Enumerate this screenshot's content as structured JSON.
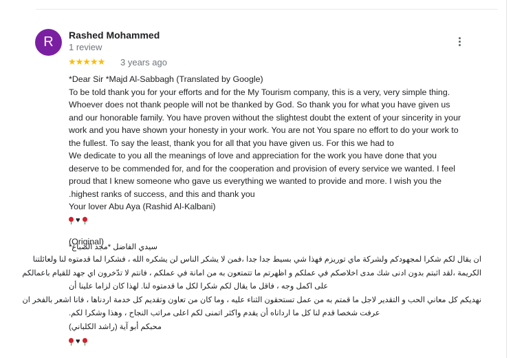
{
  "review": {
    "avatar_letter": "R",
    "avatar_color": "#7b1fa2",
    "author": "Rashed Mohammed",
    "review_count": "1 review",
    "rating": 5,
    "stars": "★★★★★",
    "time_ago": "3 years ago",
    "translated_lines": [
      "*Dear Sir *Majd Al-Sabbagh (Translated by Google)",
      "To be told thank you for your efforts and for the My Tourism company, this is a very, very simple thing.",
      "Whoever does not thank people will not be thanked by God. So thank you for what you have given us",
      "and our honorable family. You have proven without the slightest doubt the extent of your sincerity in your",
      "work and you have shown your honesty in your work. You are not You spare no effort to do your work to",
      "the fullest. To say the least, thank you for all that you have given us. For this we had to",
      "We dedicate to you all the meanings of love and appreciation for the work you have done that you",
      "deserve to be commended for, and for the cooperation and provision of every service we wanted. I feel",
      "proud that I knew someone who gave us everything we wanted to provide and more. I wish you the",
      ".highest ranks of success, and this and thank you",
      "Your lover Abu Aya (Rashid Al-Kalbani)"
    ],
    "original_heading": "(Original)",
    "original_lines": [
      "سيدي الفاضل *مجد الصباغ*",
      "ان يقال لكم شكرا لمجهودكم ولشركة ماي توريزم  فهذا شي بسيط جدا جدا  ،فمن لا يشكر الناس لن يشكره الله ، فشكرا لما قدمتوه لنا ولعائلتنا",
      "الكريمة ،لقد اثبتم بدون ادنى شك مدى اخلاصكم في عملكم و اظهرتم ما تتمتعون به من امانة في عملكم ، فانتم لا تدّخرون اي جهد للقيام باعمالكم",
      "على اكمل وجه ، فاقل ما يقال لكم شكرا لكل ما قدمتوه لنا. لهذا كان لزاما علينا أن",
      "نهديكم كل معاني الحب و التقدير لاجل ما قمتم به من عمل تستحقون الثناء عليه ، وما كان من تعاون وتقديم كل خدمة اردناها ، فانا اشعر بالفخر ان",
      "عرفت شخصا قدم لنا كل ما ارداناه أن يقدم واكثر  اتمنى لكم اعلى مراتب النجاح ، وهذا  وشكرا لكم.",
      "محبكم أبو آية (راشد الكلباني)"
    ]
  }
}
